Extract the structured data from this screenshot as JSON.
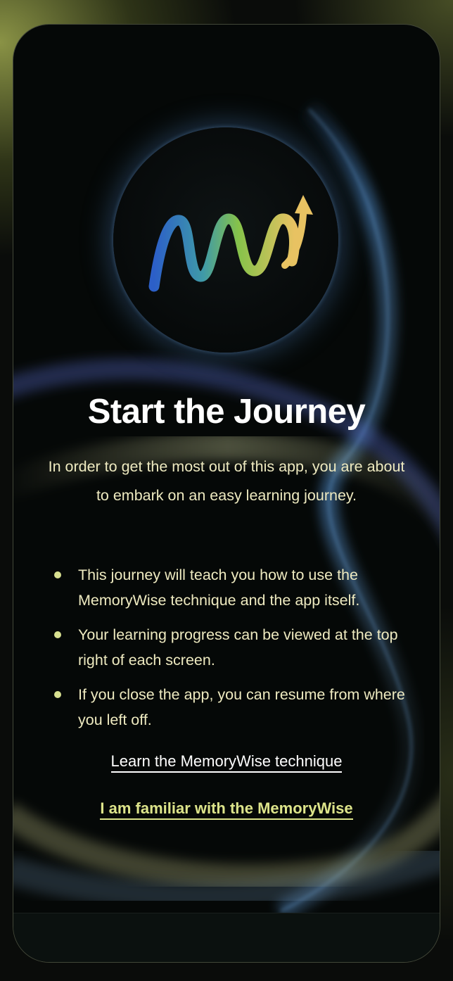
{
  "onboarding": {
    "title": "Start the Journey",
    "intro": "In order to get the most out of this app, you are about to embark on an easy learning journey.",
    "bullets": [
      "This journey will teach you how to use the MemoryWise technique and the app itself.",
      "Your learning progress can be viewed at the top right of each screen.",
      "If you close the app, you can resume from where you left off."
    ],
    "learn_link": "Learn the MemoryWise technique",
    "familiar_link": "I am familiar with the MemoryWise"
  },
  "logo": {
    "icon": "memorywise-wave-arrow-logo",
    "colors": [
      "#2f6fd0",
      "#3aa3a0",
      "#7cc04a",
      "#e8c060"
    ]
  },
  "colors": {
    "accent": "#dde48a",
    "text": "#eeeac0",
    "title": "#ffffff",
    "background": "#050807"
  }
}
